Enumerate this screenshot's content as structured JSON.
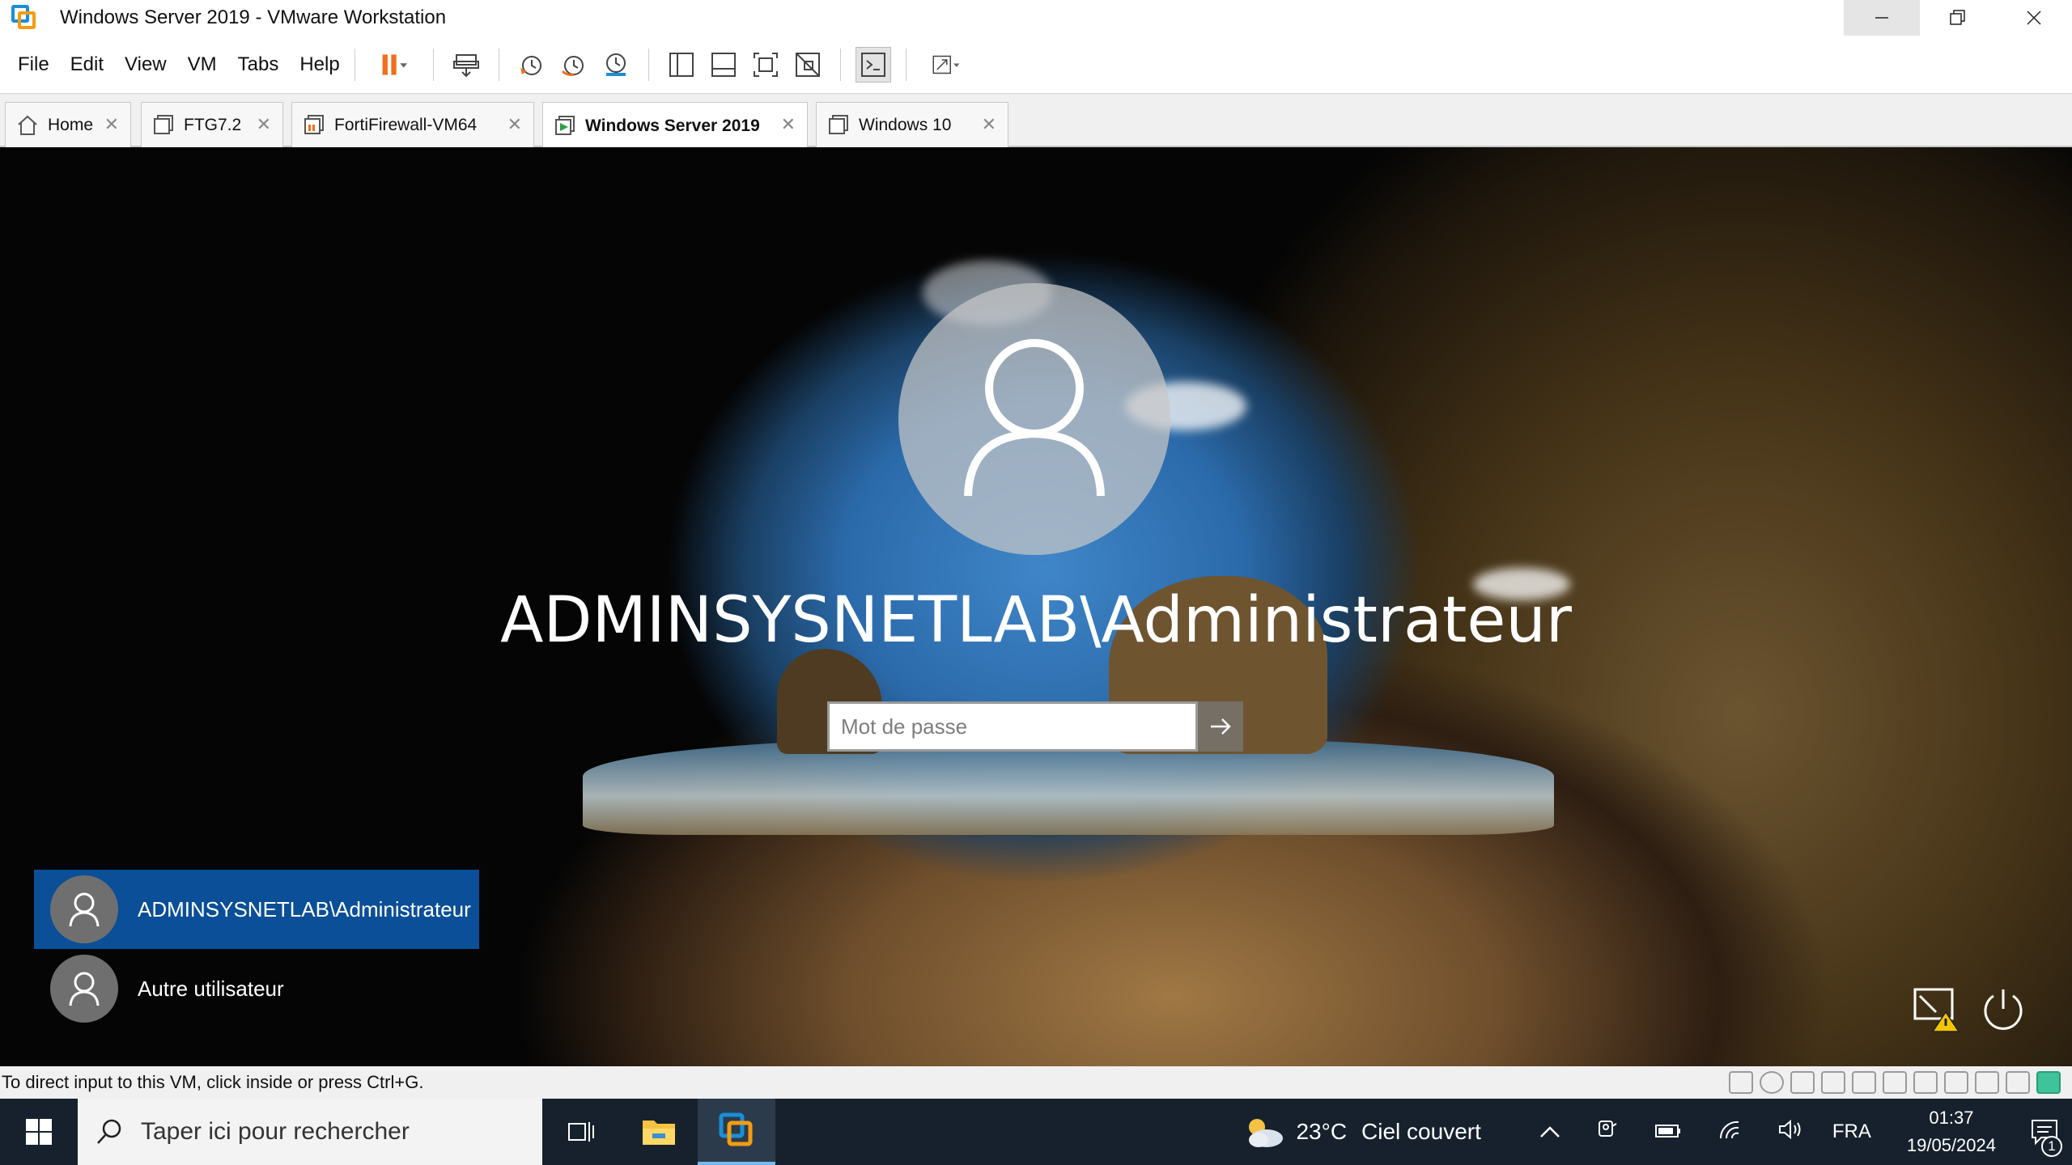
{
  "window": {
    "title": "Windows Server 2019 - VMware Workstation",
    "minimize_icon": "minimize-icon",
    "restore_icon": "restore-icon",
    "close_icon": "close-icon"
  },
  "menu": {
    "items": [
      "File",
      "Edit",
      "View",
      "VM",
      "Tabs",
      "Help"
    ]
  },
  "tabs": [
    {
      "label": "Home",
      "icon": "home-icon",
      "active": false
    },
    {
      "label": "FTG7.2",
      "icon": "vm-icon",
      "active": false
    },
    {
      "label": "FortiFirewall-VM64",
      "icon": "vm-icon",
      "active": false
    },
    {
      "label": "Windows Server 2019",
      "icon": "vm-running-icon",
      "active": true
    },
    {
      "label": "Windows 10",
      "icon": "vm-icon",
      "active": false
    }
  ],
  "login": {
    "user_name": "ADMINSYSNETLAB\\Administrateur",
    "password_placeholder": "Mot de passe",
    "users": [
      {
        "label": "ADMINSYSNETLAB\\Administrateur",
        "selected": true
      },
      {
        "label": "Autre utilisateur",
        "selected": false
      }
    ]
  },
  "status": {
    "hint": "To direct input to this VM, click inside or press Ctrl+G."
  },
  "taskbar": {
    "search_placeholder": "Taper ici pour rechercher",
    "weather_temp": "23°C",
    "weather_text": "Ciel couvert",
    "language": "FRA",
    "time": "01:37",
    "date": "19/05/2024",
    "notification_count": "1"
  },
  "colors": {
    "selected_user": "#0a4f97",
    "taskbar": "#16212d",
    "pause_orange": "#f06e1c"
  }
}
